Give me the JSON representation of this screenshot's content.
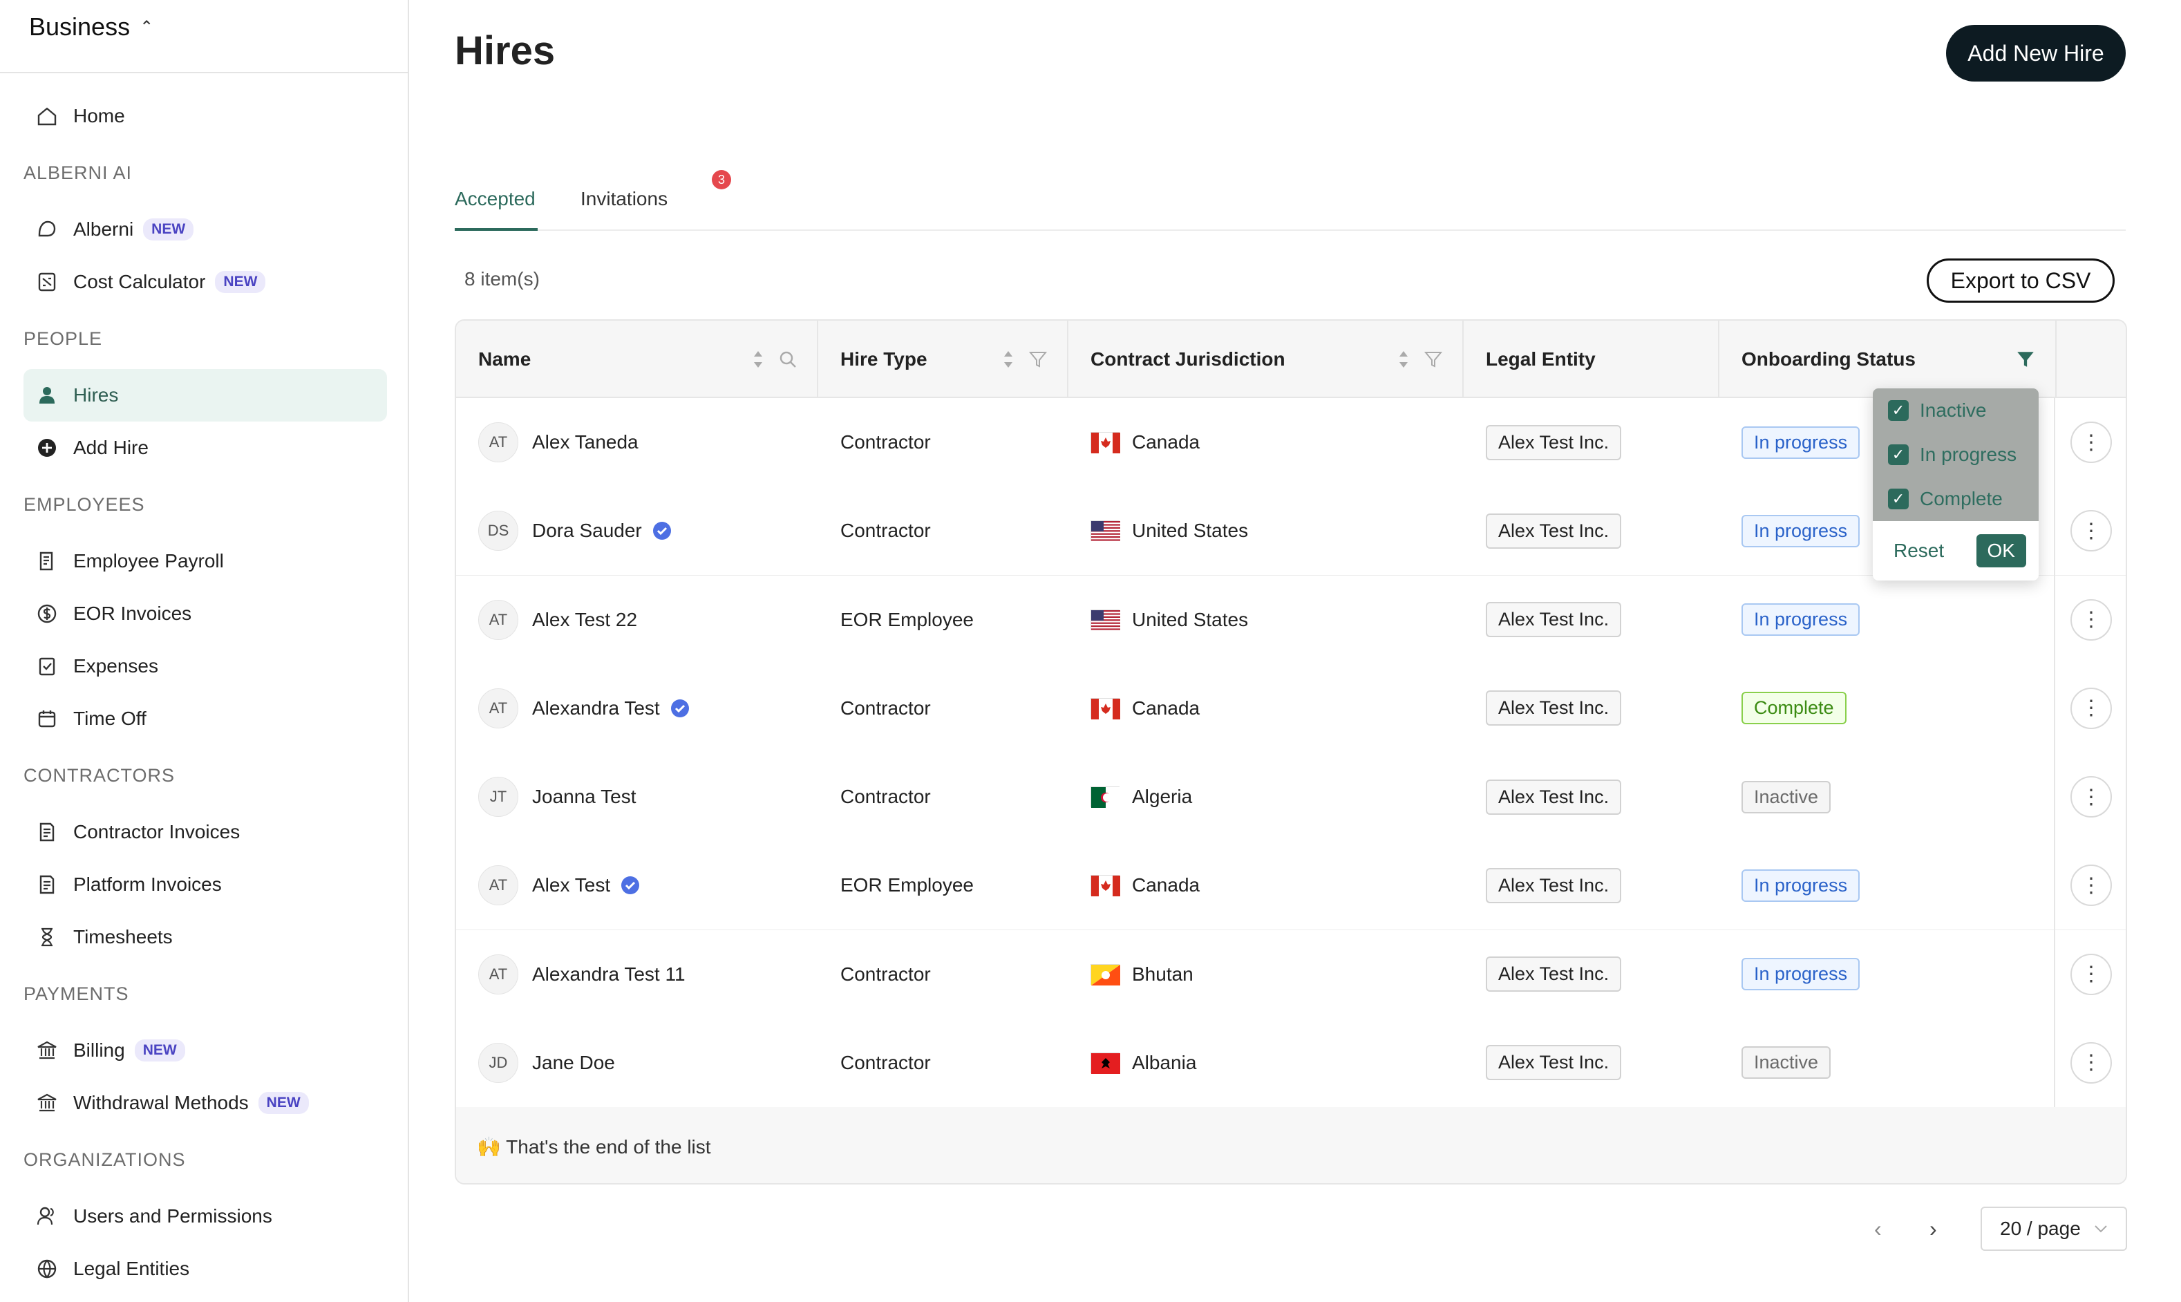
{
  "sidebar": {
    "workspace": "Business",
    "items": [
      {
        "type": "item",
        "label": "Home",
        "icon": "home-icon"
      },
      {
        "type": "section",
        "label": "ALBERNI AI"
      },
      {
        "type": "item",
        "label": "Alberni",
        "icon": "chat-icon",
        "badge": "NEW"
      },
      {
        "type": "item",
        "label": "Cost Calculator",
        "icon": "calculator-icon",
        "badge": "NEW"
      },
      {
        "type": "section",
        "label": "PEOPLE"
      },
      {
        "type": "item",
        "label": "Hires",
        "icon": "person-icon",
        "active": true
      },
      {
        "type": "item",
        "label": "Add Hire",
        "icon": "plus-circle-icon"
      },
      {
        "type": "section",
        "label": "EMPLOYEES"
      },
      {
        "type": "item",
        "label": "Employee Payroll",
        "icon": "document-icon"
      },
      {
        "type": "item",
        "label": "EOR Invoices",
        "icon": "dollar-icon"
      },
      {
        "type": "item",
        "label": "Expenses",
        "icon": "checklist-icon"
      },
      {
        "type": "item",
        "label": "Time Off",
        "icon": "calendar-icon"
      },
      {
        "type": "section",
        "label": "CONTRACTORS"
      },
      {
        "type": "item",
        "label": "Contractor Invoices",
        "icon": "invoice-icon"
      },
      {
        "type": "item",
        "label": "Platform Invoices",
        "icon": "invoice-icon"
      },
      {
        "type": "item",
        "label": "Timesheets",
        "icon": "hourglass-icon"
      },
      {
        "type": "section",
        "label": "PAYMENTS"
      },
      {
        "type": "item",
        "label": "Billing",
        "icon": "bank-icon",
        "badge": "NEW"
      },
      {
        "type": "item",
        "label": "Withdrawal Methods",
        "icon": "bank-icon",
        "badge": "NEW"
      },
      {
        "type": "section",
        "label": "ORGANIZATIONS"
      },
      {
        "type": "item",
        "label": "Users and Permissions",
        "icon": "users-icon"
      },
      {
        "type": "item",
        "label": "Legal Entities",
        "icon": "globe-icon"
      }
    ]
  },
  "header": {
    "title": "Hires",
    "add_button": "Add New Hire"
  },
  "tabs": {
    "accepted": "Accepted",
    "invitations": "Invitations",
    "invitations_count": "3"
  },
  "toolbar": {
    "item_count": "8 item(s)",
    "export_label": "Export to CSV"
  },
  "table": {
    "columns": [
      "Name",
      "Hire Type",
      "Contract Jurisdiction",
      "Legal Entity",
      "Onboarding Status"
    ],
    "rows": [
      {
        "initials": "AT",
        "name": "Alex Taneda",
        "verified": false,
        "type": "Contractor",
        "country": "Canada",
        "flag": "ca",
        "entity": "Alex Test Inc.",
        "status": "In progress"
      },
      {
        "initials": "DS",
        "name": "Dora Sauder",
        "verified": true,
        "type": "Contractor",
        "country": "United States",
        "flag": "us",
        "entity": "Alex Test Inc.",
        "status": "In progress"
      },
      {
        "initials": "AT",
        "name": "Alex Test 22",
        "verified": false,
        "type": "EOR Employee",
        "country": "United States",
        "flag": "us",
        "entity": "Alex Test Inc.",
        "status": "In progress"
      },
      {
        "initials": "AT",
        "name": "Alexandra Test",
        "verified": true,
        "type": "Contractor",
        "country": "Canada",
        "flag": "ca",
        "entity": "Alex Test Inc.",
        "status": "Complete"
      },
      {
        "initials": "JT",
        "name": "Joanna Test",
        "verified": false,
        "type": "Contractor",
        "country": "Algeria",
        "flag": "dz",
        "entity": "Alex Test Inc.",
        "status": "Inactive"
      },
      {
        "initials": "AT",
        "name": "Alex Test",
        "verified": true,
        "type": "EOR Employee",
        "country": "Canada",
        "flag": "ca",
        "entity": "Alex Test Inc.",
        "status": "In progress"
      },
      {
        "initials": "AT",
        "name": "Alexandra Test 11",
        "verified": false,
        "type": "Contractor",
        "country": "Bhutan",
        "flag": "bt",
        "entity": "Alex Test Inc.",
        "status": "In progress"
      },
      {
        "initials": "JD",
        "name": "Jane Doe",
        "verified": false,
        "type": "Contractor",
        "country": "Albania",
        "flag": "al",
        "entity": "Alex Test Inc.",
        "status": "Inactive"
      }
    ],
    "end_text": "🙌 That's the end of the list"
  },
  "status_filter": {
    "options": [
      {
        "label": "Inactive",
        "checked": true
      },
      {
        "label": "In progress",
        "checked": true
      },
      {
        "label": "Complete",
        "checked": true
      }
    ],
    "reset": "Reset",
    "ok": "OK"
  },
  "pagination": {
    "page_size": "20 / page"
  },
  "colors": {
    "accent": "#2c6a5c",
    "primary_button": "#0d1b22",
    "badge_red": "#e5484d",
    "verified_blue": "#4d6fe3"
  }
}
